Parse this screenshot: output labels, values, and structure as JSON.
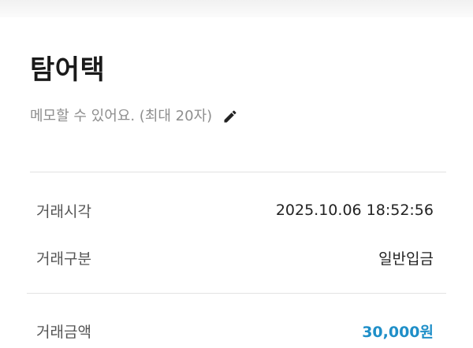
{
  "header": {
    "title": "탐어택",
    "memo_placeholder": "메모할 수 있어요. (최대 20자)"
  },
  "details": [
    {
      "label": "거래시각",
      "value": "2025.10.06 18:52:56"
    },
    {
      "label": "거래구분",
      "value": "일반입금"
    }
  ],
  "amount": {
    "label": "거래금액",
    "value": "30,000원"
  },
  "icons": {
    "edit": "pencil-icon"
  },
  "colors": {
    "amount": "#1f8fc8"
  }
}
